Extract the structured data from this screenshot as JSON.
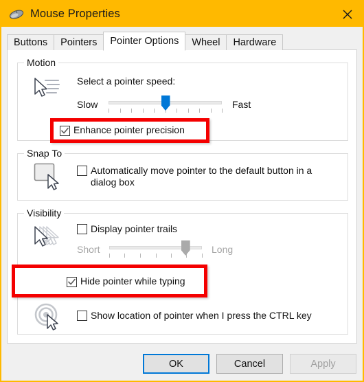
{
  "window": {
    "title": "Mouse Properties",
    "icon": "mouse-icon",
    "close_label": "✕",
    "titlebar_color": "#ffb900",
    "accent_color": "#0078d7",
    "annotation_color": "#f40000"
  },
  "tabs": [
    {
      "label": "Buttons",
      "active": false
    },
    {
      "label": "Pointers",
      "active": false
    },
    {
      "label": "Pointer Options",
      "active": true
    },
    {
      "label": "Wheel",
      "active": false
    },
    {
      "label": "Hardware",
      "active": false
    }
  ],
  "motion": {
    "group_label": "Motion",
    "icon": "pointer-speed-icon",
    "prompt": "Select a pointer speed:",
    "slider": {
      "min_label": "Slow",
      "max_label": "Fast",
      "value_percent": 50,
      "tick_count": 11,
      "enabled": true
    },
    "enhance_precision": {
      "label": "Enhance pointer precision",
      "checked": true,
      "highlighted": true
    }
  },
  "snap_to": {
    "group_label": "Snap To",
    "icon": "snap-to-default-button-icon",
    "auto_move": {
      "label": "Automatically move pointer to the default button in a dialog box",
      "checked": false
    }
  },
  "visibility": {
    "group_label": "Visibility",
    "trails": {
      "icon": "pointer-trails-icon",
      "label": "Display pointer trails",
      "checked": false,
      "slider": {
        "min_label": "Short",
        "max_label": "Long",
        "value_percent": 82,
        "tick_count": 7,
        "enabled": false
      }
    },
    "hide_while_typing": {
      "icon": "hide-pointer-typing-icon",
      "label": "Hide pointer while typing",
      "checked": true,
      "highlighted": true
    },
    "show_location_ctrl": {
      "icon": "show-pointer-location-icon",
      "label": "Show location of pointer when I press the CTRL key",
      "checked": false
    }
  },
  "footer": {
    "ok_label": "OK",
    "cancel_label": "Cancel",
    "apply_label": "Apply",
    "apply_enabled": false
  }
}
